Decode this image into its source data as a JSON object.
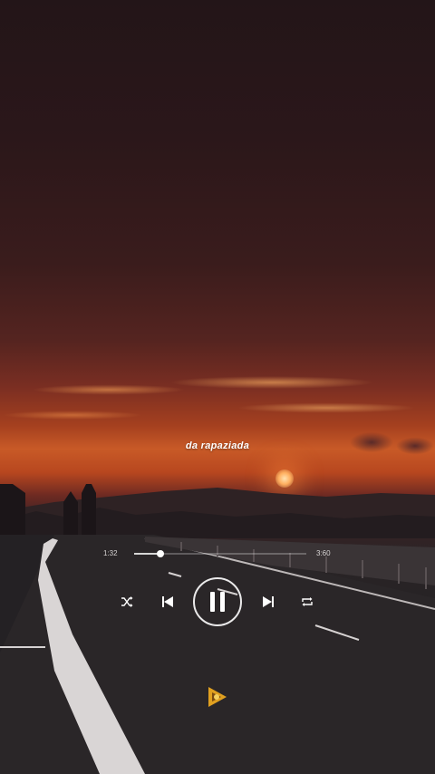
{
  "overlay": {
    "caption": "da rapaziada"
  },
  "player": {
    "elapsed": "1:32",
    "total": "3:60",
    "progress": 0.15,
    "state": "playing",
    "controls": [
      "shuffle-icon",
      "previous-icon",
      "pause-icon",
      "next-icon",
      "repeat-icon"
    ]
  },
  "colors": {
    "sky_top": "#231518",
    "sunset_orange": "#c85a27",
    "road": "#252224",
    "controls": "#ffffff"
  },
  "logo": {
    "icon": "app-logo-icon"
  }
}
